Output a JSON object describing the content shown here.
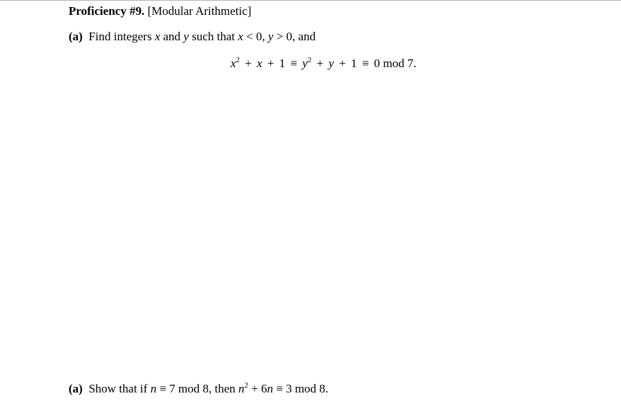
{
  "header": {
    "label": "Proficiency #9.",
    "topic": "[Modular Arithmetic]"
  },
  "problems": [
    {
      "label": "(a)",
      "text_parts": [
        "Find integers",
        "x",
        "and",
        "y",
        "such that",
        "x",
        "< 0,",
        "y",
        "> 0, and"
      ],
      "display_equation": {
        "var1": "x",
        "exp": "2",
        "plus": "+",
        "one": "1",
        "equiv": "≡",
        "var2": "y",
        "zero": "0",
        "mod_text": "mod 7."
      }
    },
    {
      "label": "(a)",
      "text_parts": [
        "Show that if",
        "n",
        "≡ 7 mod 8, then",
        "n",
        "2",
        "+ 6",
        "n",
        "≡ 3 mod 8."
      ]
    }
  ],
  "colors": {
    "top_rule": "#b4b4b4",
    "text": "#000000"
  }
}
